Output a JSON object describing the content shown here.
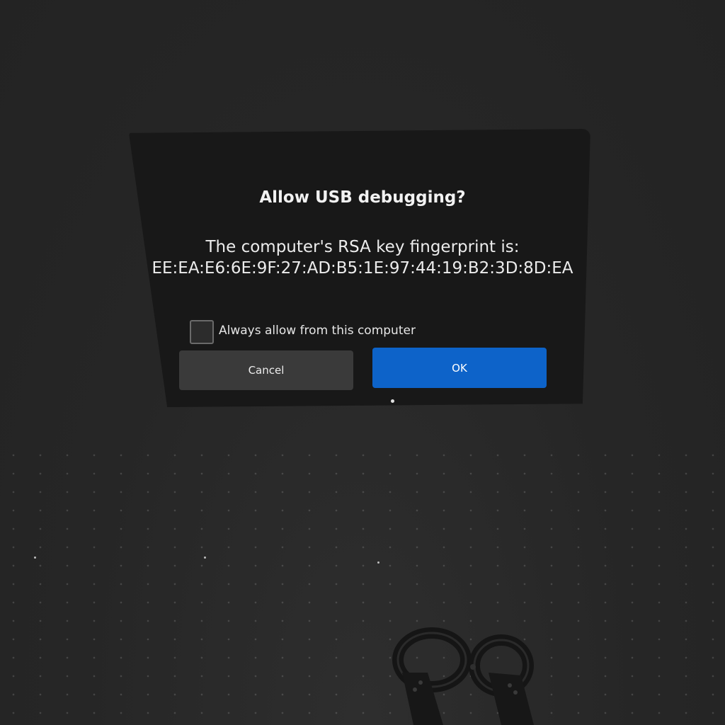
{
  "dialog": {
    "title": "Allow USB debugging?",
    "message_line1": "The computer's RSA key fingerprint is:",
    "fingerprint": "EE:EA:E6:6E:9F:27:AD:B5:1E:97:44:19:B2:3D:8D:EA",
    "checkbox_label": "Always allow from this computer",
    "checkbox_checked": false,
    "cancel_label": "Cancel",
    "ok_label": "OK"
  },
  "colors": {
    "background": "#262626",
    "dialog": "#181818",
    "ok_button": "#0d63c9",
    "cancel_button": "#3a3a3a"
  },
  "icons": {
    "controllers": "vr-controllers-icon"
  }
}
